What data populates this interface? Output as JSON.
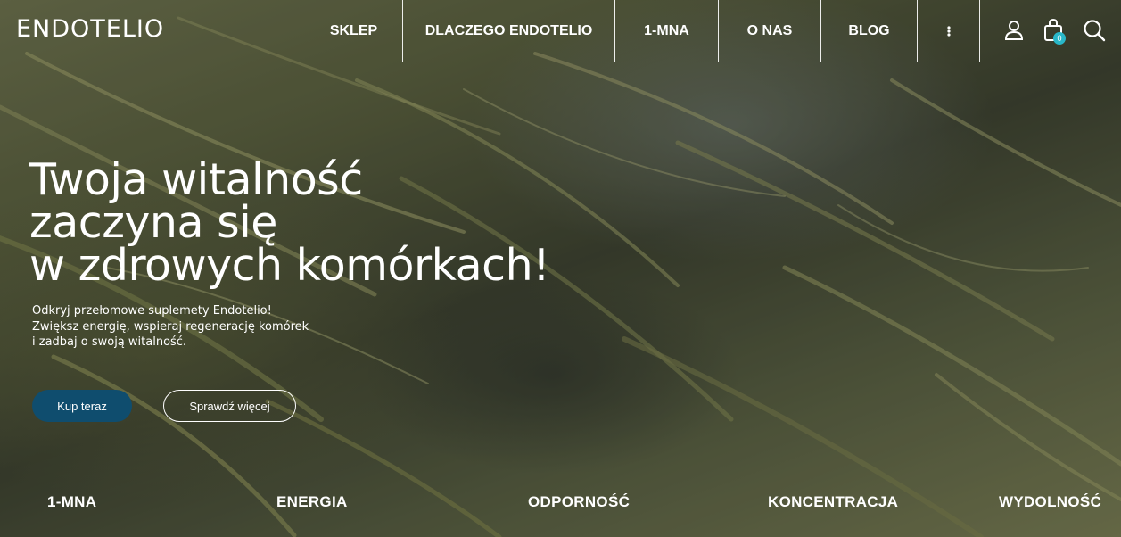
{
  "brand": {
    "logo_text": "ENDOTELIO"
  },
  "nav": {
    "items": [
      {
        "label": "SKLEP"
      },
      {
        "label": "DLACZEGO ENDOTELIO"
      },
      {
        "label": "1-MNA"
      },
      {
        "label": "O NAS"
      },
      {
        "label": "BLOG"
      }
    ],
    "more_icon": "vertical-dots-icon"
  },
  "header_icons": {
    "account_icon": "user-icon",
    "cart_icon": "shopping-bag-icon",
    "cart_count": "0",
    "search_icon": "search-icon"
  },
  "hero": {
    "title_lines": [
      "Twoja witalność",
      "zaczyna się",
      "w zdrowych komórkach!"
    ],
    "subtitle_lines": [
      "Odkryj przełomowe suplemety Endotelio!",
      "Zwiększ energię, wspieraj regenerację komórek",
      "i zadbaj o swoją witalność."
    ],
    "primary_button": "Kup teraz",
    "secondary_button": "Sprawdź więcej"
  },
  "categories": [
    {
      "label": "1-MNA"
    },
    {
      "label": "ENERGIA"
    },
    {
      "label": "ODPORNOŚĆ"
    },
    {
      "label": "KONCENTRACJA"
    },
    {
      "label": "WYDOLNOŚĆ"
    }
  ],
  "colors": {
    "primary_button_bg": "#0f4d6e",
    "cart_badge_bg": "#29b7c8",
    "text": "#ffffff"
  }
}
